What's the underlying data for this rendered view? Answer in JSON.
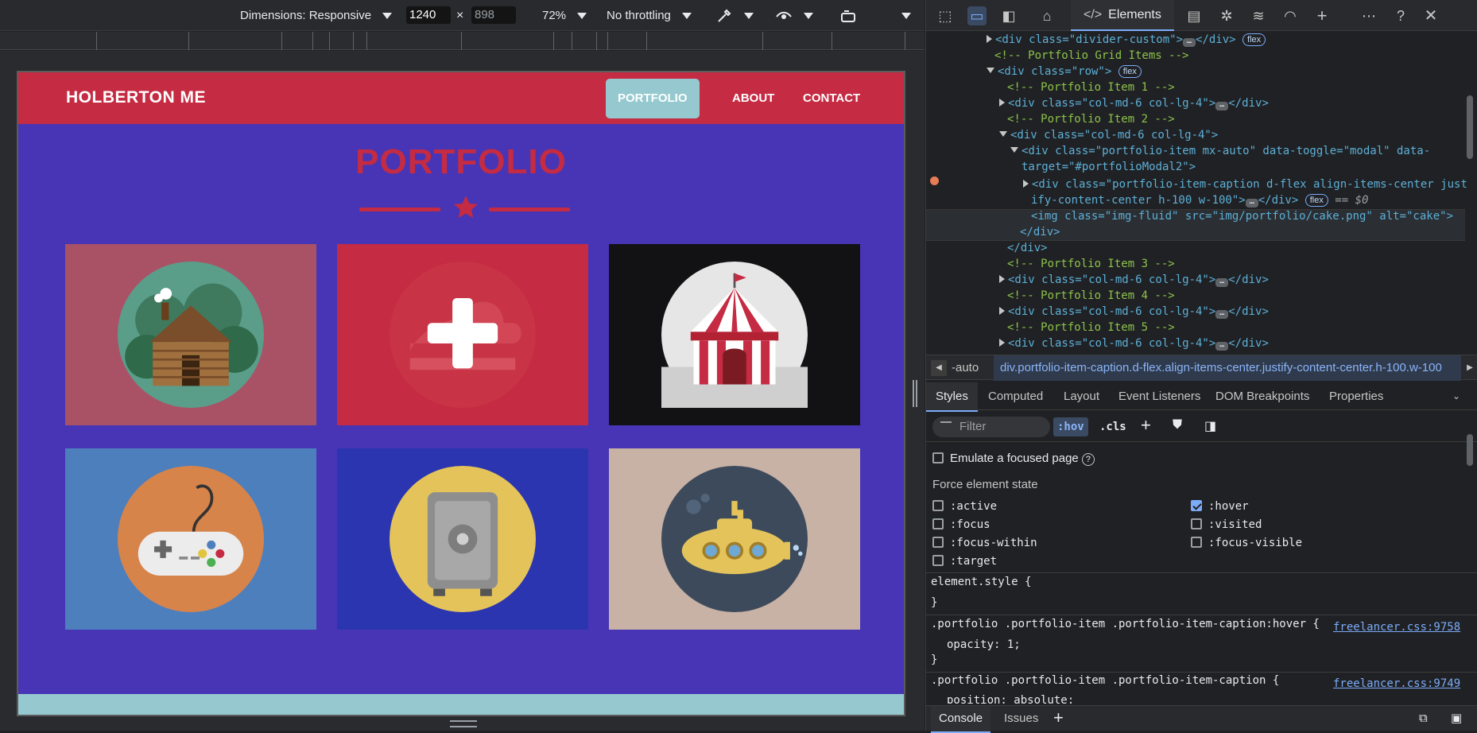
{
  "device_toolbar": {
    "dimensions": "Dimensions: Responsive",
    "width": "1240",
    "x": "×",
    "height": "898",
    "zoom": "72%",
    "throttling": "No throttling"
  },
  "site": {
    "brand": "HOLBERTON ME",
    "nav": [
      "PORTFOLIO",
      "ABOUT",
      "CONTACT"
    ],
    "title": "PORTFOLIO",
    "items": [
      {
        "name": "cabin",
        "bg": "#a95266"
      },
      {
        "name": "cake",
        "bg": "#c52b42"
      },
      {
        "name": "circus",
        "bg": "#121113"
      },
      {
        "name": "game",
        "bg": "#4e7fbd"
      },
      {
        "name": "safe",
        "bg": "#2c35b0"
      },
      {
        "name": "submarine",
        "bg": "#c8b1a5"
      }
    ]
  },
  "devtools": {
    "tab": "Elements",
    "tree": [
      {
        "t": "<div class=\"divider-custom\">",
        "badge": "flex"
      },
      {
        "t": "<!-- Portfolio Grid Items -->"
      },
      {
        "t": "<div class=\"row\">",
        "badge": "flex"
      },
      {
        "t": "<!-- Portfolio Item 1 -->"
      },
      {
        "t": "<div class=\"col-md-6 col-lg-4\">"
      },
      {
        "t": "<!-- Portfolio Item 2 -->"
      },
      {
        "t": "<div class=\"col-md-6 col-lg-4\">"
      },
      {
        "t": "<div class=\"portfolio-item mx-auto\" data-toggle=\"modal\" data-"
      },
      {
        "t": "target=\"#portfolioModal2\">"
      },
      {
        "t": "<div class=\"portfolio-item-caption d-flex align-items-center just"
      },
      {
        "t": "ify-content-center h-100 w-100\">",
        "badge": "flex",
        "tail": "== $0"
      },
      {
        "t": "<img class=\"img-fluid\" src=\"img/portfolio/cake.png\" alt=\"cake\">"
      },
      {
        "t": "</div>"
      },
      {
        "t": "</div>"
      },
      {
        "t": "<!-- Portfolio Item 3 -->"
      },
      {
        "t": "<div class=\"col-md-6 col-lg-4\">"
      },
      {
        "t": "<!-- Portfolio Item 4 -->"
      },
      {
        "t": "<div class=\"col-md-6 col-lg-4\">"
      },
      {
        "t": "<!-- Portfolio Item 5 -->"
      },
      {
        "t": "<div class=\"col-md-6 col-lg-4\">"
      }
    ],
    "breadcrumb": [
      "-auto",
      "div.portfolio-item-caption.d-flex.align-items-center.justify-content-center.h-100.w-100"
    ],
    "subtabs": [
      "Styles",
      "Computed",
      "Layout",
      "Event Listeners",
      "DOM Breakpoints",
      "Properties"
    ],
    "filter_placeholder": "Filter",
    "hov": ":hov",
    "cls": ".cls",
    "emulate": "Emulate a focused page",
    "force_state": "Force element state",
    "states_left": [
      ":active",
      ":focus",
      ":focus-within",
      ":target"
    ],
    "states_right": [
      ":hover",
      ":visited",
      ":focus-visible"
    ],
    "rules": [
      {
        "selector": "element.style {",
        "close": "}"
      },
      {
        "selector": ".portfolio .portfolio-item .portfolio-item-caption:hover {",
        "source": "freelancer.css:9758",
        "decl": "opacity: 1;",
        "close": "}"
      },
      {
        "selector": ".portfolio .portfolio-item .portfolio-item-caption {",
        "source": "freelancer.css:9749",
        "decl": "position: absolute;"
      }
    ],
    "console_tabs": [
      "Console",
      "Issues"
    ]
  }
}
